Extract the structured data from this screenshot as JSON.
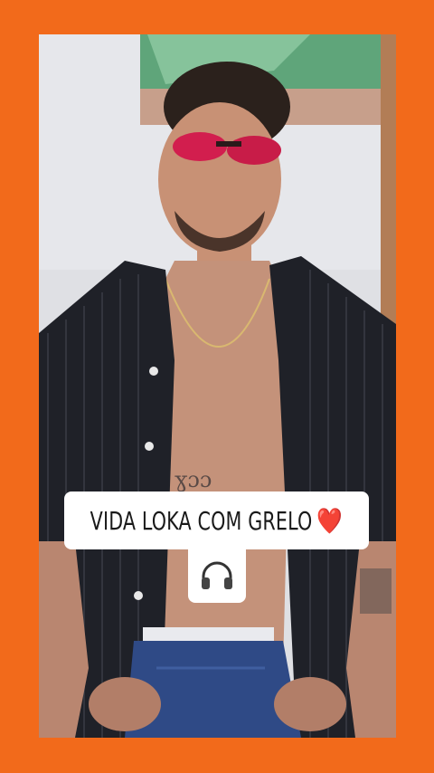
{
  "caption": {
    "line1": "VIDA LOKA COM GRELO",
    "line1_emoji": "❤️",
    "line2_icon": "headphones-icon"
  },
  "colors": {
    "border": "#f26a1b",
    "caption_bg": "#ffffff",
    "heart": "#e0202c"
  }
}
